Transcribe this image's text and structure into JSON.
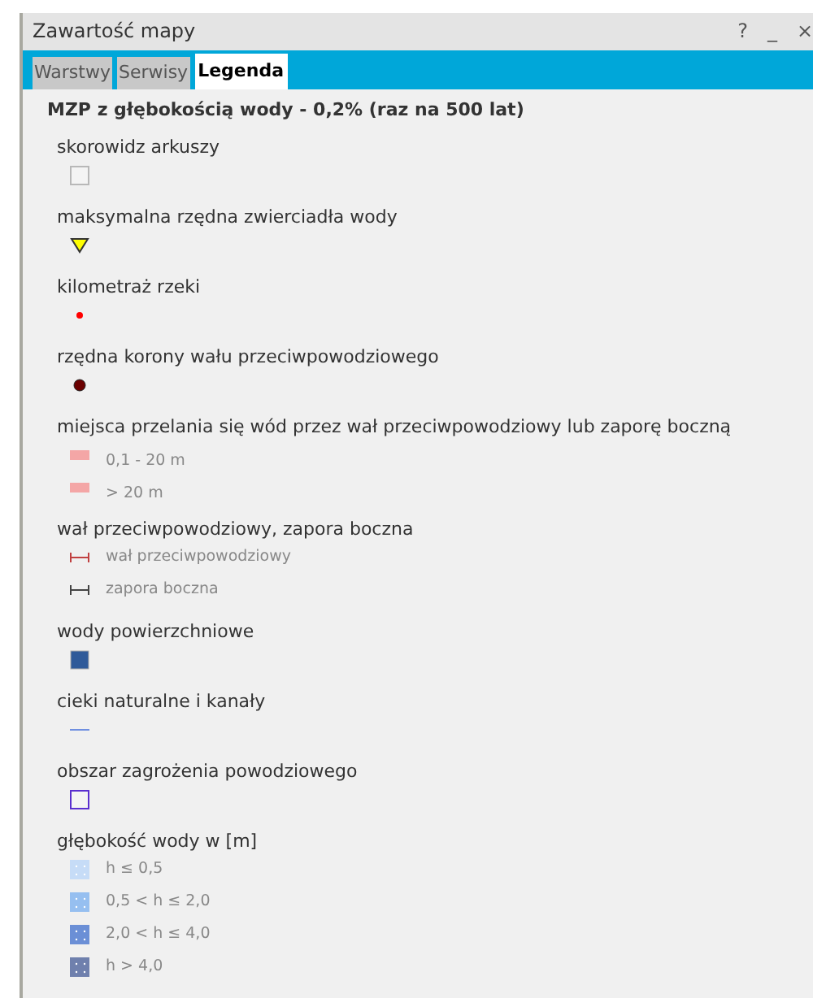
{
  "window": {
    "title": "Zawartość mapy",
    "controls": [
      "?",
      "_",
      "×"
    ]
  },
  "tabs": [
    {
      "label": "Warstwy",
      "selected": false
    },
    {
      "label": "Serwisy",
      "selected": false
    },
    {
      "label": "Legenda",
      "selected": true
    }
  ],
  "heading": "MZP z głębokością wody - 0,2% (raz na 500 lat)",
  "sections": [
    {
      "title": "skorowidz arkuszy",
      "items": [
        {
          "kind": "outline-square",
          "color": "#b8b8b8"
        }
      ]
    },
    {
      "title": "maksymalna rzędna zwierciadła wody",
      "items": [
        {
          "kind": "triangle",
          "color": "#ffff00"
        }
      ]
    },
    {
      "title": "kilometraż rzeki",
      "items": [
        {
          "kind": "small-dot",
          "color": "#ff0000"
        }
      ]
    },
    {
      "title": "rzędna korony wału przeciwpowodziowego",
      "items": [
        {
          "kind": "dot",
          "color": "#6b0000"
        }
      ]
    },
    {
      "title": "miejsca przelania się wód przez wał przeciwpowodziowy lub zaporę boczną",
      "items": [
        {
          "kind": "bar",
          "color": "#f4a6a6",
          "label": "0,1 - 20 m"
        },
        {
          "kind": "bar",
          "color": "#f4a6a6",
          "label": "> 20 m"
        }
      ]
    },
    {
      "title": "wał przeciwpowodziowy, zapora boczna",
      "items": [
        {
          "kind": "line-ends",
          "color": "#c04040",
          "label": "wał przeciwpowodziowy"
        },
        {
          "kind": "line-ends",
          "color": "#444444",
          "label": "zapora boczna"
        }
      ]
    },
    {
      "title": "wody powierzchniowe",
      "items": [
        {
          "kind": "square",
          "color": "#2f5a99"
        }
      ]
    },
    {
      "title": "cieki naturalne i kanały",
      "items": [
        {
          "kind": "line",
          "color": "#6f8fe0"
        }
      ]
    },
    {
      "title": "obszar zagrożenia powodziowego",
      "items": [
        {
          "kind": "outline-square",
          "color": "#5a2fcf"
        }
      ]
    },
    {
      "title": "głębokość wody w [m]",
      "items": [
        {
          "kind": "dotted-square",
          "color": "#c6dcf7",
          "label": "h ≤ 0,5"
        },
        {
          "kind": "dotted-square",
          "color": "#96bff0",
          "label": "0,5 < h ≤ 2,0"
        },
        {
          "kind": "dotted-square",
          "color": "#6b8fd6",
          "label": "2,0 < h ≤ 4,0"
        },
        {
          "kind": "dotted-square",
          "color": "#6f80ad",
          "label": "h > 4,0"
        }
      ]
    }
  ]
}
